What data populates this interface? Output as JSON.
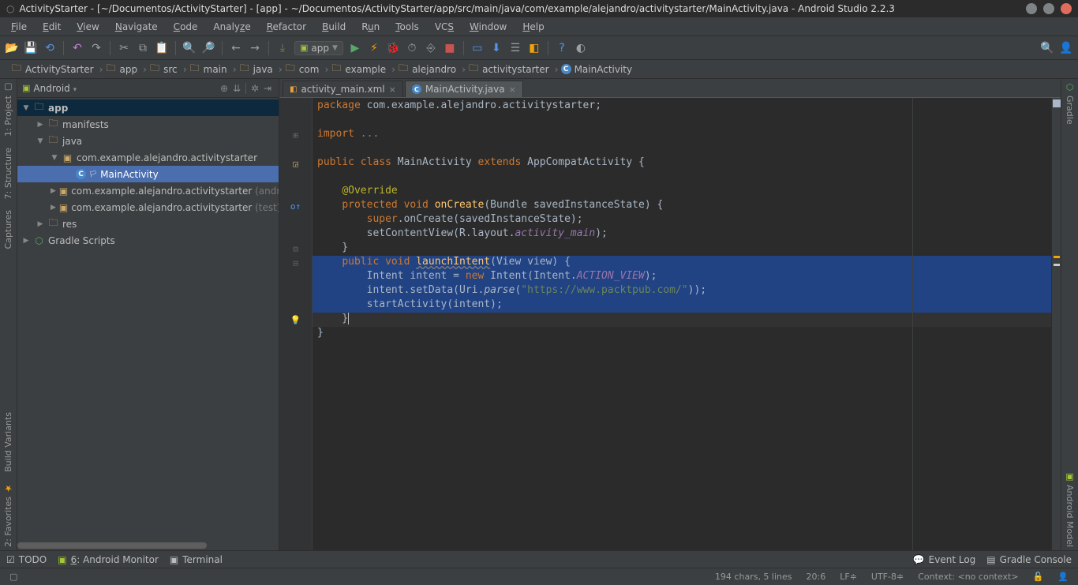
{
  "window": {
    "title": "ActivityStarter - [~/Documentos/ActivityStarter] - [app] - ~/Documentos/ActivityStarter/app/src/main/java/com/example/alejandro/activitystarter/MainActivity.java - Android Studio 2.2.3"
  },
  "menu": {
    "file": "File",
    "edit": "Edit",
    "view": "View",
    "navigate": "Navigate",
    "code": "Code",
    "analyze": "Analyze",
    "refactor": "Refactor",
    "build": "Build",
    "run": "Run",
    "tools": "Tools",
    "vcs": "VCS",
    "window": "Window",
    "help": "Help"
  },
  "toolbar": {
    "config": "app"
  },
  "breadcrumb": {
    "items": [
      {
        "icon": "folder",
        "label": "ActivityStarter"
      },
      {
        "icon": "folder",
        "label": "app"
      },
      {
        "icon": "folder",
        "label": "src"
      },
      {
        "icon": "folder",
        "label": "main"
      },
      {
        "icon": "folder",
        "label": "java"
      },
      {
        "icon": "folder",
        "label": "com"
      },
      {
        "icon": "folder",
        "label": "example"
      },
      {
        "icon": "folder",
        "label": "alejandro"
      },
      {
        "icon": "folder",
        "label": "activitystarter"
      },
      {
        "icon": "class",
        "label": "MainActivity"
      }
    ]
  },
  "left_tools": {
    "project": "1: Project",
    "structure": "7: Structure",
    "captures": "Captures",
    "favorites": "2: Favorites",
    "buildvariants": "Build Variants"
  },
  "right_tools": {
    "gradle": "Gradle",
    "androidmodel": "Android Model"
  },
  "project": {
    "view": "Android",
    "root": "app",
    "manifests": "manifests",
    "java": "java",
    "pkg1": "com.example.alejandro.activitystarter",
    "mainactivity": "MainActivity",
    "pkg2": "com.example.alejandro.activitystarter",
    "pkg2suffix": " (androidTest)",
    "pkg3": "com.example.alejandro.activitystarter",
    "pkg3suffix": " (test)",
    "res": "res",
    "gradle": "Gradle Scripts"
  },
  "tabs": {
    "t0": "activity_main.xml",
    "t1": "MainActivity.java"
  },
  "code": {
    "l0_kw": "package ",
    "l0_rest": "com.example.alejandro.activitystarter;",
    "l2_kw": "import ",
    "l2_rest": "...",
    "l4_kw1": "public class ",
    "l4_name": "MainActivity ",
    "l4_kw2": "extends ",
    "l4_sup": "AppCompatActivity {",
    "l6_ann": "@Override",
    "l7_kw": "protected void ",
    "l7_name": "onCreate",
    "l7_rest": "(Bundle savedInstanceState) {",
    "l8_kw": "super",
    "l8_rest": ".onCreate(savedInstanceState);",
    "l9a": "        setContentView(R.layout.",
    "l9_ital": "activity_main",
    "l9b": ");",
    "l10": "    }",
    "l11_kw": "public void ",
    "l11_name": "launchIntent",
    "l11_rest": "(View view) {",
    "l12a": "        Intent intent = ",
    "l12_kw": "new ",
    "l12b": "Intent(Intent.",
    "l12_ital": "ACTION_VIEW",
    "l12c": ");",
    "l13a": "        intent.setData(Uri.",
    "l13_ital": "parse",
    "l13b": "(",
    "l13_str": "\"https://www.packtpub.com/\"",
    "l13c": "));",
    "l14": "        startActivity(intent);",
    "l15": "    }",
    "l16": "}"
  },
  "bottom": {
    "todo": "TODO",
    "monitor": "6: Android Monitor",
    "terminal": "Terminal",
    "eventlog": "Event Log",
    "gradleconsole": "Gradle Console"
  },
  "status": {
    "selection": "194 chars, 5 lines",
    "pos": "20:6",
    "lf": "LF",
    "enc": "UTF-8",
    "ctx": "Context: <no context>"
  }
}
